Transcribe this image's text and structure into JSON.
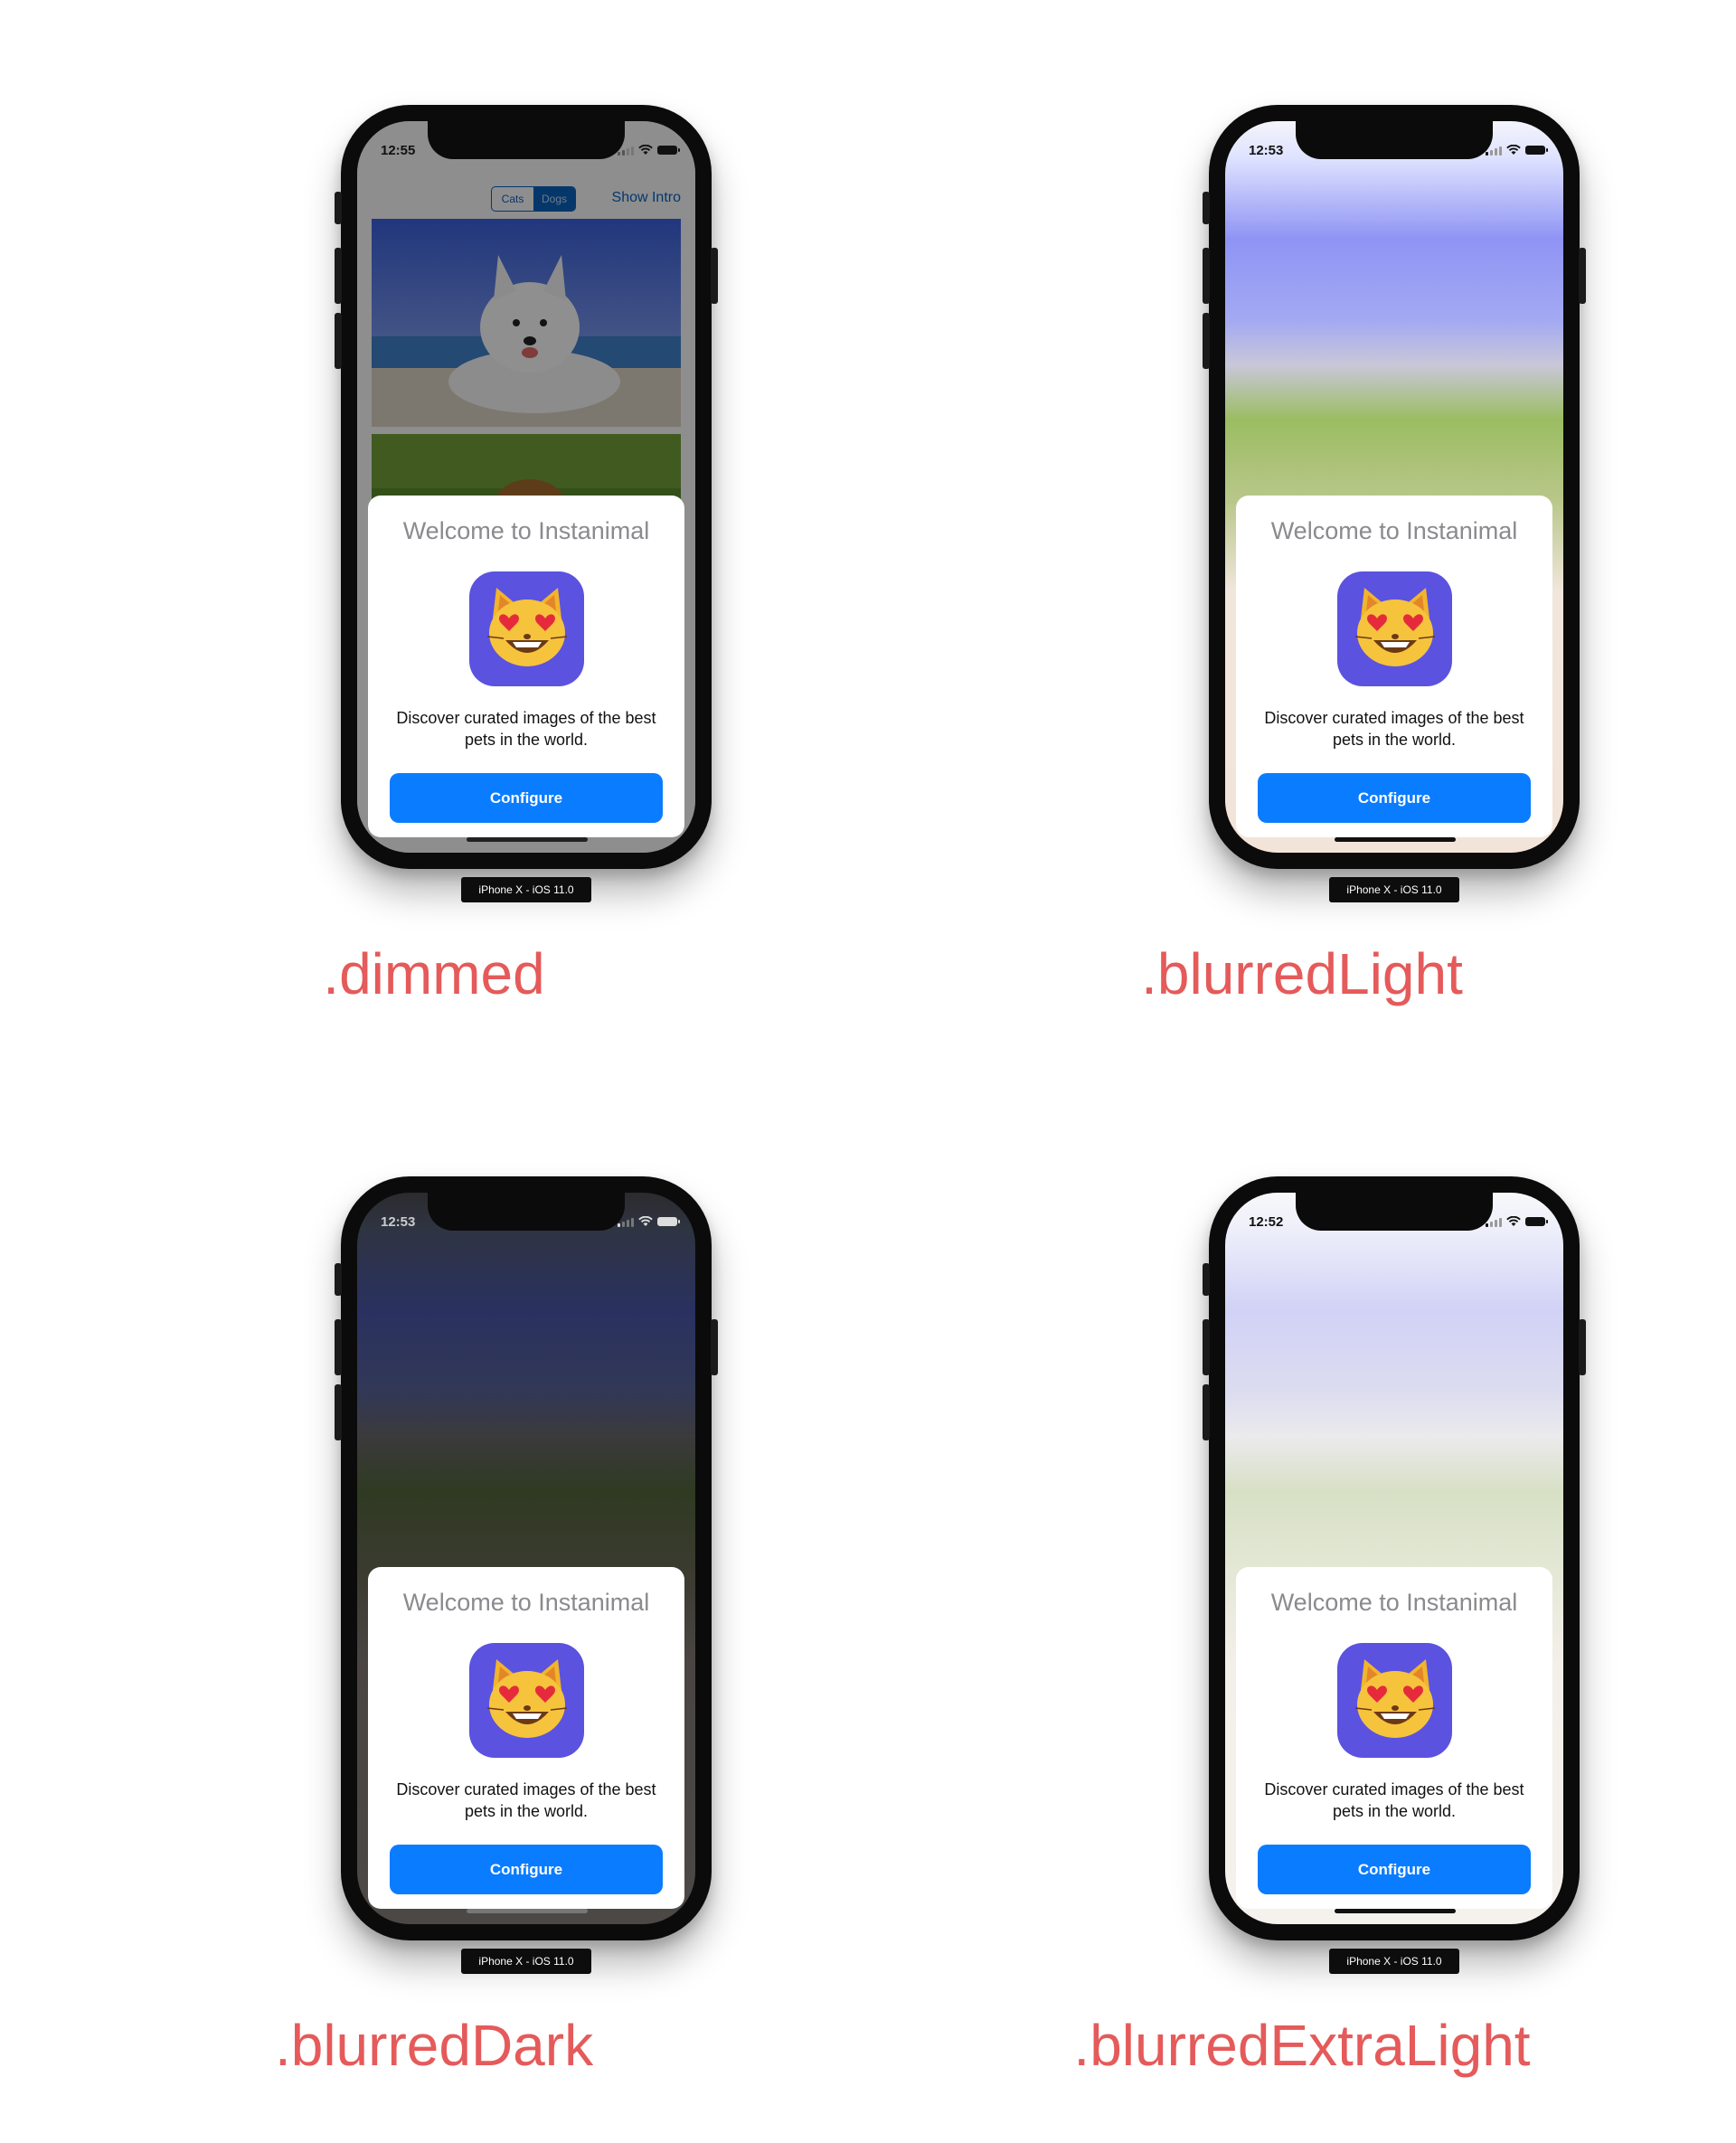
{
  "panels": [
    {
      "style": "dimmed",
      "caption": ".dimmed",
      "status": {
        "time": "12:55",
        "theme": "light"
      },
      "nav": {
        "segments": [
          "Cats",
          "Dogs"
        ],
        "selected_segment": "Dogs",
        "show_intro": "Show Intro"
      },
      "card": {
        "title": "Welcome to Instanimal",
        "description": "Discover curated images of the best pets in the world.",
        "button": "Configure"
      },
      "device_label": "iPhone X - iOS 11.0"
    },
    {
      "style": "blurredLight",
      "caption": ".blurredLight",
      "status": {
        "time": "12:53",
        "theme": "dark"
      },
      "card": {
        "title": "Welcome to Instanimal",
        "description": "Discover curated images of the best pets in the world.",
        "button": "Configure"
      },
      "device_label": "iPhone X - iOS 11.0"
    },
    {
      "style": "blurredDark",
      "caption": ".blurredDark",
      "status": {
        "time": "12:53",
        "theme": "light"
      },
      "card": {
        "title": "Welcome to Instanimal",
        "description": "Discover curated images of the best pets in the world.",
        "button": "Configure"
      },
      "device_label": "iPhone X - iOS 11.0"
    },
    {
      "style": "blurredExtraLight",
      "caption": ".blurredExtraLight",
      "status": {
        "time": "12:52",
        "theme": "dark"
      },
      "card": {
        "title": "Welcome to Instanimal",
        "description": "Discover curated images of the best pets in the world.",
        "button": "Configure"
      },
      "device_label": "iPhone X - iOS 11.0"
    }
  ],
  "colors": {
    "caption": "#e55a5a",
    "button": "#0a7cff",
    "app_icon": "#5b52e0",
    "card_title": "#8a8a8f"
  },
  "icons": {
    "app_icon_glyph": "heart-eyes-cat-icon"
  }
}
